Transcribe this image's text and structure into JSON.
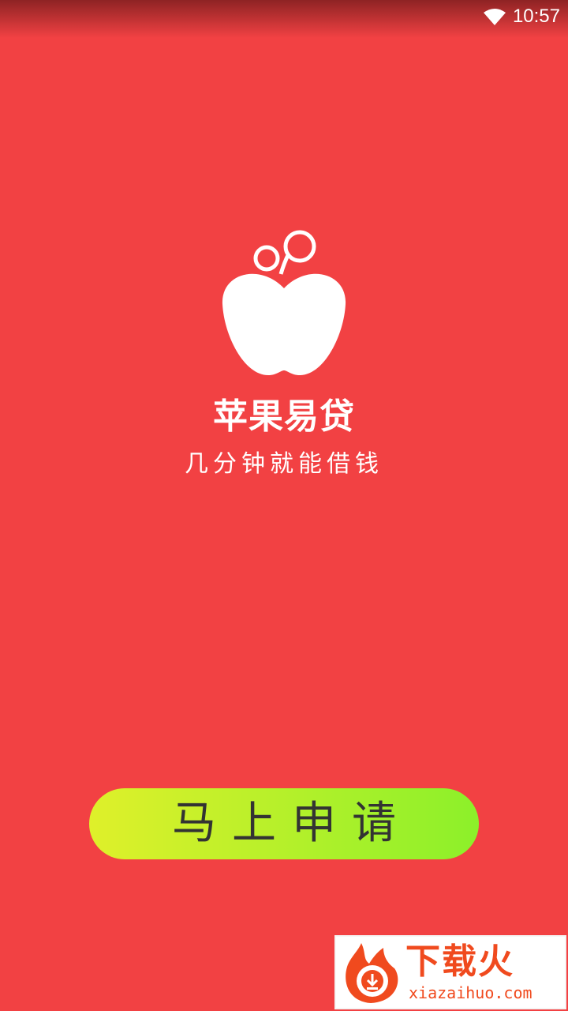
{
  "status_bar": {
    "time": "10:57",
    "wifi_icon": "wifi-icon"
  },
  "app": {
    "logo_icon": "apple-logo-icon",
    "title": "苹果易贷",
    "tagline": "几分钟就能借钱"
  },
  "actions": {
    "apply_label": "马上申请"
  },
  "watermark": {
    "brand": "下载火",
    "url": "xiazaihuo.com"
  },
  "colors": {
    "background": "#f24143",
    "button_gradient_start": "#dff02a",
    "button_gradient_end": "#8cf02a",
    "button_text": "#333333",
    "watermark_brand": "#f04a1e"
  }
}
